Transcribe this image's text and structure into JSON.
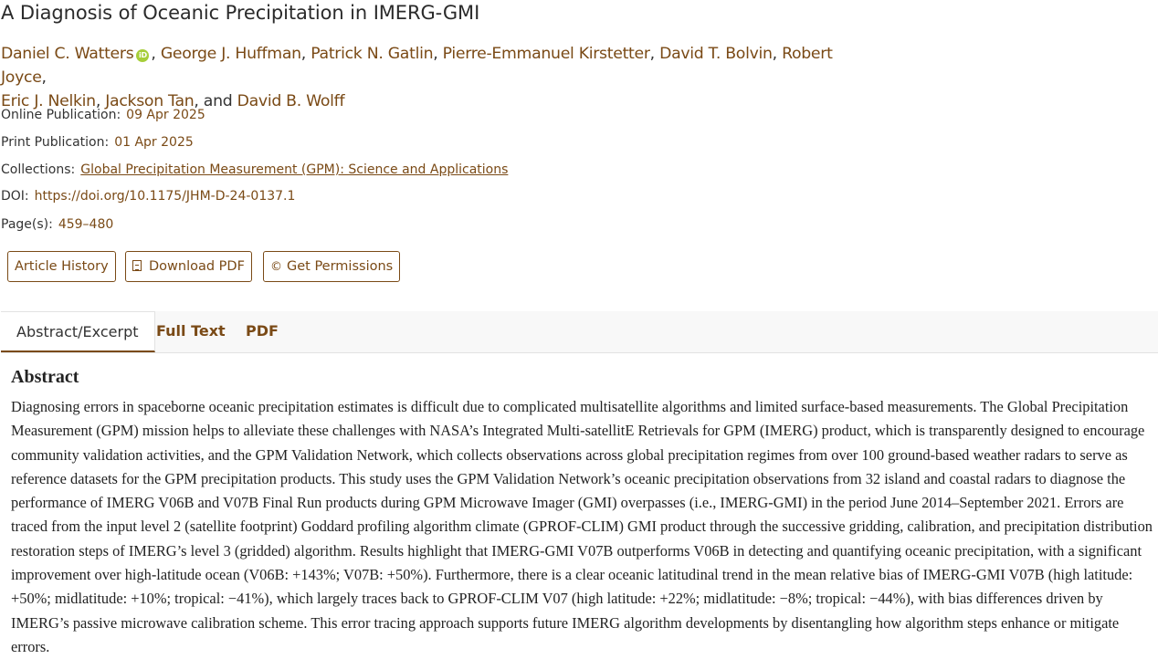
{
  "article": {
    "title": "A Diagnosis of Oceanic Precipitation in IMERG-GMI",
    "authors": [
      "Daniel C. Watters",
      "George J. Huffman",
      "Patrick N. Gatlin",
      "Pierre-Emmanuel Kirstetter",
      "David T. Bolvin",
      "Robert Joyce",
      "Eric J. Nelkin",
      "Jackson Tan",
      "David B. Wolff"
    ],
    "author_separators": {
      "comma": ",",
      "and": ", and"
    },
    "orcid_label": "iD"
  },
  "meta": {
    "online_label": "Online Publication:",
    "online_value": "09 Apr 2025",
    "print_label": "Print Publication:",
    "print_value": "01 Apr 2025",
    "collections_label": "Collections:",
    "collections_value": "Global Precipitation Measurement (GPM): Science and Applications",
    "doi_label": "DOI:",
    "doi_value": "https://doi.org/10.1175/JHM-D-24-0137.1",
    "pages_label": "Page(s):",
    "pages_value": "459–480"
  },
  "buttons": {
    "history": "Article History",
    "download": "Download PDF",
    "permissions": "Get Permissions",
    "permissions_icon": "©"
  },
  "tabs": {
    "abstract": "Abstract/Excerpt",
    "fulltext": "Full Text",
    "pdf": "PDF"
  },
  "abstract": {
    "heading": "Abstract",
    "text": "Diagnosing errors in spaceborne oceanic precipitation estimates is difficult due to complicated multisatellite algorithms and limited surface-based measurements. The Global Precipitation Measurement (GPM) mission helps to alleviate these challenges with NASA’s Integrated Multi-satellitE Retrievals for GPM (IMERG) product, which is transparently designed to encourage community validation activities, and the GPM Validation Network, which collects observations across global precipitation regimes from over 100 ground-based weather radars to serve as reference datasets for the GPM precipitation products. This study uses the GPM Validation Network’s oceanic precipitation observations from 32 island and coastal radars to diagnose the performance of IMERG V06B and V07B Final Run products during GPM Microwave Imager (GMI) overpasses (i.e., IMERG-GMI) in the period June 2014–September 2021. Errors are traced from the input level 2 (satellite footprint) Goddard profiling algorithm climate (GPROF-CLIM) GMI product through the successive gridding, calibration, and precipitation distribution restoration steps of IMERG’s level 3 (gridded) algorithm. Results highlight that IMERG-GMI V07B outperforms V06B in detecting and quantifying oceanic precipitation, with a significant improvement over high-latitude ocean (V06B: +143%; V07B: +50%). Furthermore, there is a clear oceanic latitudinal trend in the mean relative bias of IMERG-GMI V07B (high latitude: +50%; midlatitude: +10%; tropical: −41%), which largely traces back to GPROF-CLIM V07 (high latitude: +22%; midlatitude: −8%; tropical: −44%), with bias differences driven by IMERG’s passive microwave calibration scheme. This error tracing approach supports future IMERG algorithm developments by disentangling how algorithm steps enhance or mitigate errors."
  },
  "colors": {
    "accent": "#7a4a16",
    "orcid": "#a6ce39",
    "tab_bar": "#f8f8f8"
  }
}
